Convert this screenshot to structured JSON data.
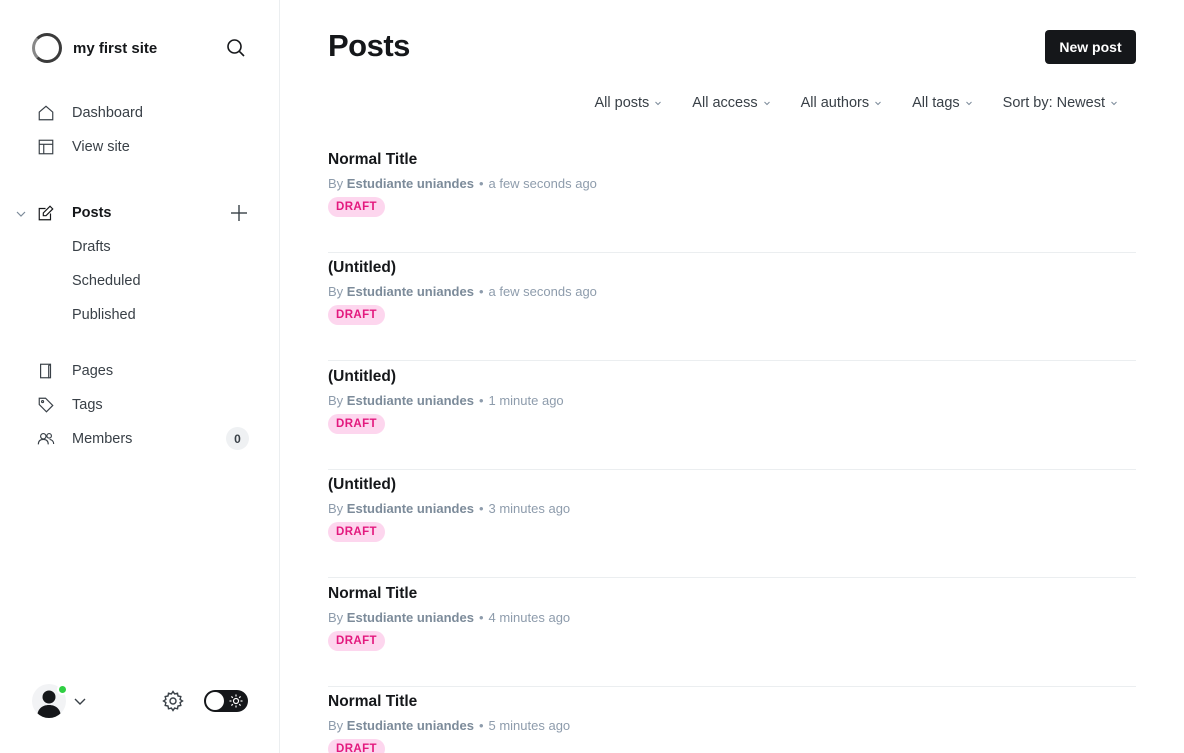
{
  "site": {
    "title": "my first site"
  },
  "nav": {
    "dashboard": "Dashboard",
    "view_site": "View site",
    "posts": "Posts",
    "drafts": "Drafts",
    "scheduled": "Scheduled",
    "published": "Published",
    "pages": "Pages",
    "tags": "Tags",
    "members": "Members",
    "members_count": "0"
  },
  "header": {
    "title": "Posts",
    "new_post_label": "New post"
  },
  "filters": {
    "type": "All posts",
    "access": "All access",
    "authors": "All authors",
    "tags": "All tags",
    "sort": "Sort by: Newest"
  },
  "posts": [
    {
      "title": "Normal Title",
      "by": "By",
      "author": "Estudiante uniandes",
      "time": "a few seconds ago",
      "status": "DRAFT"
    },
    {
      "title": "(Untitled)",
      "by": "By",
      "author": "Estudiante uniandes",
      "time": "a few seconds ago",
      "status": "DRAFT"
    },
    {
      "title": "(Untitled)",
      "by": "By",
      "author": "Estudiante uniandes",
      "time": "1 minute ago",
      "status": "DRAFT"
    },
    {
      "title": "(Untitled)",
      "by": "By",
      "author": "Estudiante uniandes",
      "time": "3 minutes ago",
      "status": "DRAFT"
    },
    {
      "title": "Normal Title",
      "by": "By",
      "author": "Estudiante uniandes",
      "time": "4 minutes ago",
      "status": "DRAFT"
    },
    {
      "title": "Normal Title",
      "by": "By",
      "author": "Estudiante uniandes",
      "time": "5 minutes ago",
      "status": "DRAFT"
    }
  ],
  "colors": {
    "accent": "#15171a",
    "draft_bg": "#fdd6ee",
    "draft_text": "#e3197e",
    "online": "#30cf43"
  }
}
